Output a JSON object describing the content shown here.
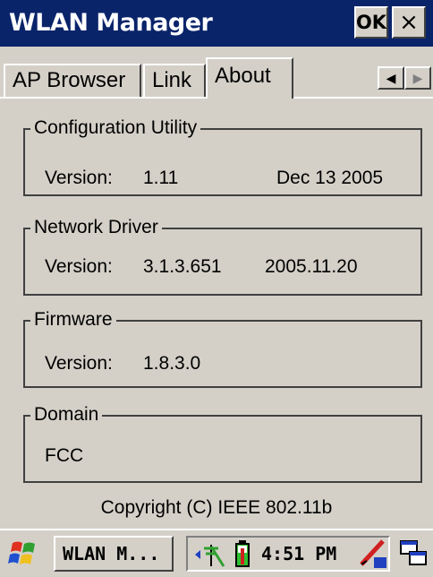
{
  "window": {
    "title": "WLAN Manager",
    "ok_label": "OK",
    "close_label": "×"
  },
  "tabs": [
    {
      "label": "AP Browser"
    },
    {
      "label": "Link"
    },
    {
      "label": "About",
      "active": true
    }
  ],
  "groups": {
    "config": {
      "title": "Configuration Utility",
      "version_label": "Version:",
      "version": "1.11",
      "date": "Dec 13 2005"
    },
    "driver": {
      "title": "Network Driver",
      "version_label": "Version:",
      "version": "3.1.3.651",
      "date": "2005.11.20"
    },
    "firmware": {
      "title": "Firmware",
      "version_label": "Version:",
      "version": "1.8.3.0"
    },
    "domain": {
      "title": "Domain",
      "value": "FCC"
    }
  },
  "copyright": "Copyright (C)  IEEE  802.11b",
  "taskbar": {
    "task_label": "WLAN M...",
    "clock": "4:51 PM"
  },
  "icons": [
    "windows-start-icon",
    "network-antenna-icon",
    "battery-icon",
    "pen-input-icon",
    "desktop-windows-icon",
    "scroll-left-icon",
    "scroll-right-icon"
  ],
  "colors": {
    "titlebar": "#0a246a",
    "background": "#d4d0c8"
  }
}
